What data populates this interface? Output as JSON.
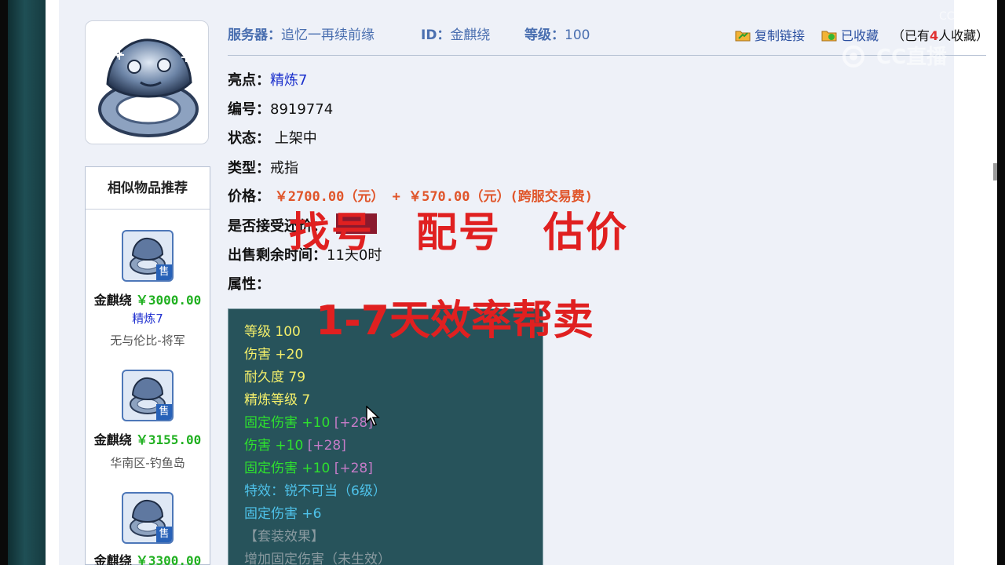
{
  "header": {
    "server_label": "服务器：",
    "server_value": "追忆一再续前缘",
    "id_label": "ID：",
    "id_value": "金麒绕",
    "level_label": "等级：",
    "level_value": "100",
    "copy_link": "复制链接",
    "favorited": "已收藏",
    "fav_count_prefix": "（已有",
    "fav_count": "4",
    "fav_count_suffix": "人收藏）"
  },
  "details": {
    "highlight_label": "亮点：",
    "highlight_value": "精炼7",
    "serial_label": "编号：",
    "serial_value": "8919774",
    "status_label": "状态：",
    "status_value": "上架中",
    "type_label": "类型：",
    "type_value": "戒指",
    "price_label": "价格：",
    "price_value": "￥2700.00（元） +  ￥570.00（元）(跨服交易费)",
    "accept_label": "是否接受还价：",
    "remaining_label": "出售剩余时间：",
    "remaining_value": "11天0时",
    "attr_label": "属性："
  },
  "similar": {
    "title": "相似物品推荐",
    "sale_badge": "售",
    "items": [
      {
        "name": "金麒绕",
        "price": "￥3000.00",
        "highlight": "精炼7",
        "server": "无与伦比-将军"
      },
      {
        "name": "金麒绕",
        "price": "￥3155.00",
        "server": "华南区-钓鱼岛"
      },
      {
        "name": "金麒绕",
        "price": "￥3300.00"
      }
    ]
  },
  "attributes": [
    {
      "text": "等级 100",
      "color": "yellow"
    },
    {
      "text": "伤害 +20",
      "color": "yellow"
    },
    {
      "text": "耐久度 79",
      "color": "yellow"
    },
    {
      "text": "精炼等级 7",
      "color": "yellow"
    },
    {
      "text": "固定伤害 +10",
      "extra": "[+28]",
      "color": "green"
    },
    {
      "text": "伤害 +10",
      "extra": "[+28]",
      "color": "green"
    },
    {
      "text": "固定伤害 +10",
      "extra": "[+28]",
      "color": "green"
    },
    {
      "text": "特效：锐不可当（6级）",
      "color": "cyan"
    },
    {
      "text": "固定伤害 +6",
      "color": "cyan"
    },
    {
      "text": "【套装效果】",
      "color": "gray"
    },
    {
      "text": "增加固定伤害（未生效）",
      "color": "gray"
    }
  ],
  "overlay": {
    "line1": "找号　配号　估价",
    "line2": "1-7天效率帮卖"
  },
  "watermark": "CC直播",
  "colors": {
    "price": "#e0552a",
    "similar_price": "#20b020",
    "overlay": "#e02020",
    "attr_bg": "#27535b"
  }
}
